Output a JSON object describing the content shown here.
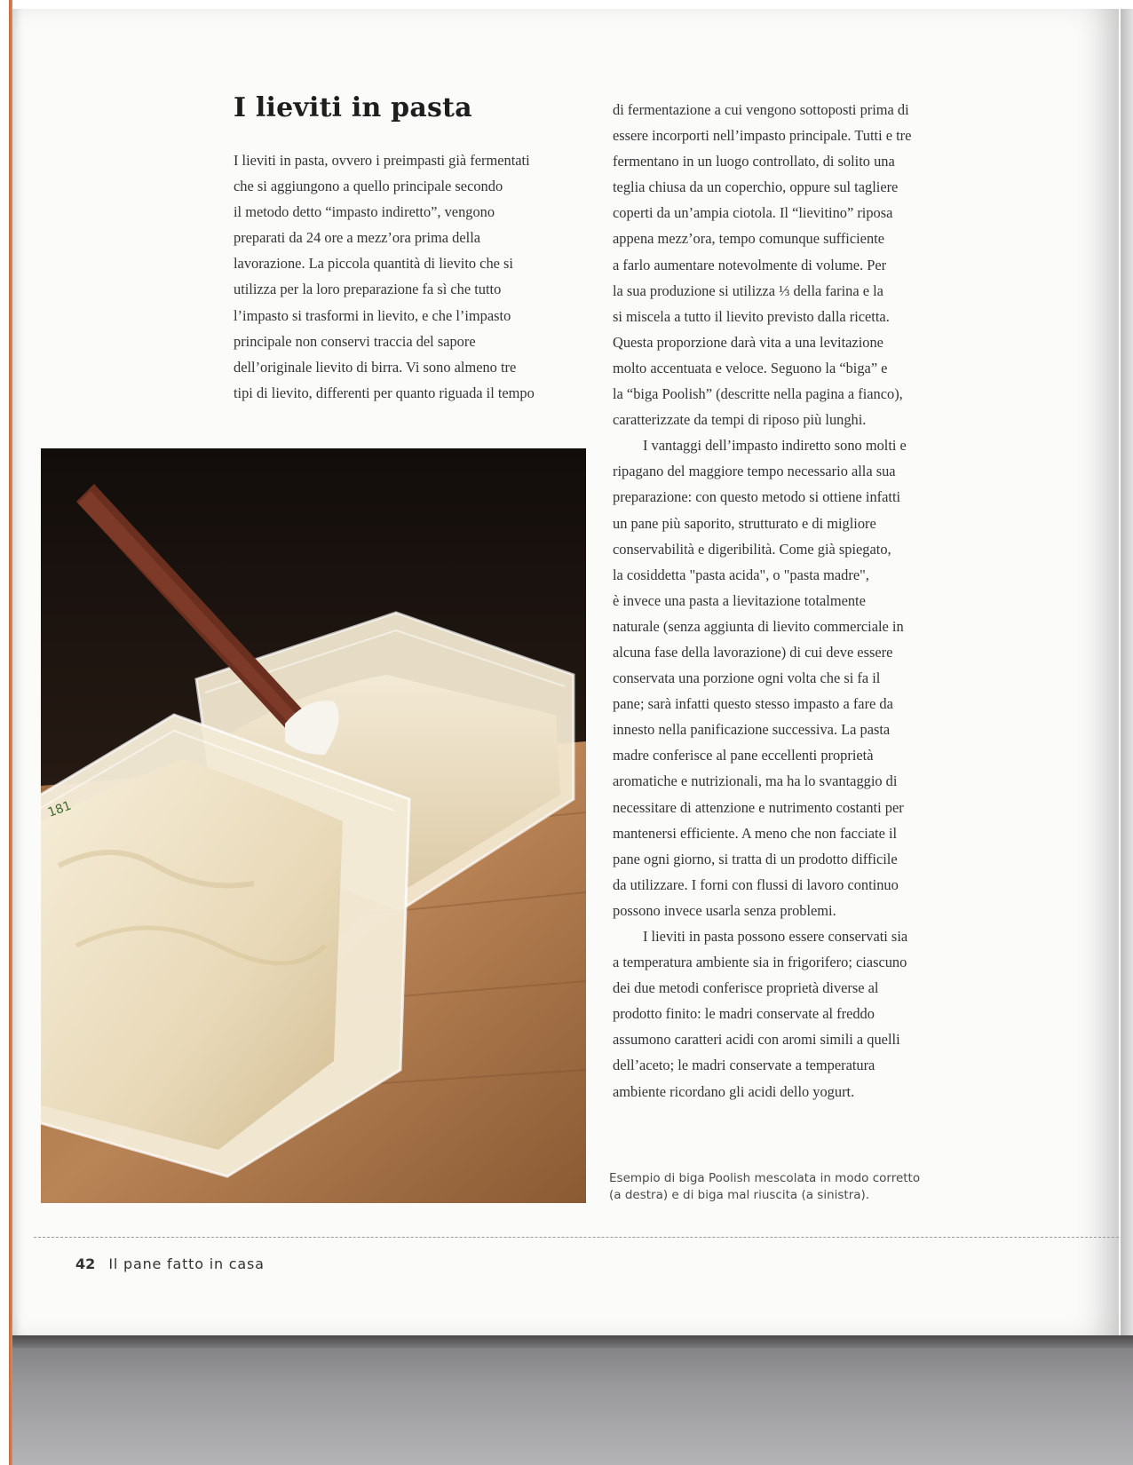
{
  "heading": "I lieviti in pasta",
  "left_column": [
    "I lieviti in pasta, ovvero i preimpasti già fermentati",
    "che si aggiungono a quello principale secondo",
    "il metodo detto “impasto indiretto”, vengono",
    "preparati da 24 ore a mezz’ora prima della",
    "lavorazione. La piccola quantità di lievito che si",
    "utilizza per la loro preparazione fa sì che tutto",
    "l’impasto si trasformi in lievito, e che l’impasto",
    "principale non conservi traccia del sapore",
    "dell’originale lievito di birra. Vi sono almeno tre",
    "tipi di lievito, differenti per quanto riguada il tempo"
  ],
  "right_column": [
    "di fermentazione a cui vengono sottoposti prima di",
    "essere incorporti nell’impasto principale. Tutti e tre",
    "fermentano in un luogo controllato, di solito una",
    "teglia chiusa da un coperchio, oppure sul tagliere",
    "coperti da un’ampia ciotola. Il “lievitino” riposa",
    "appena mezz’ora, tempo comunque sufficiente",
    "a farlo aumentare notevolmente di volume. Per",
    "la sua produzione si utilizza ⅓ della farina e la",
    "si miscela a tutto il lievito previsto dalla ricetta.",
    "Questa proporzione darà vita a una levitazione",
    "molto accentuata e veloce. Seguono la “biga” e",
    "la “biga Poolish” (descritte nella pagina a fianco),",
    "caratterizzate da tempi di riposo più lunghi.",
    "I vantaggi dell’impasto indiretto sono molti e",
    "ripagano del maggiore tempo necessario alla sua",
    "preparazione: con questo metodo si ottiene infatti",
    "un pane più saporito, strutturato e di migliore",
    "conservabilità e digeribilità. Come già spiegato,",
    "la cosiddetta \"pasta acida\", o \"pasta madre\",",
    "è invece una pasta a lievitazione totalmente",
    "naturale (senza aggiunta di lievito commerciale in",
    "alcuna fase della lavorazione) di cui deve essere",
    "conservata una porzione ogni volta che si fa il",
    "pane; sarà infatti questo stesso impasto a fare da",
    "innesto nella panificazione successiva. La pasta",
    "madre conferisce al pane eccellenti proprietà",
    "aromatiche e nutrizionali, ma ha lo svantaggio di",
    "necessitare di attenzione e nutrimento costanti per",
    "mantenersi efficiente. A meno che non facciate il",
    "pane ogni giorno, si tratta di un prodotto difficile",
    "da utilizzare. I forni con flussi di lavoro continuo",
    "possono invece usarla senza problemi.",
    "I lieviti in pasta possono essere conservati sia",
    "a temperatura ambiente sia in frigorifero; ciascuno",
    "dei due metodi conferisce proprietà diverse al",
    "prodotto finito: le madri conservate al freddo",
    "assumono caratteri acidi con aromi simili a quelli",
    "dell’aceto; le madri conservate a temperatura",
    "ambiente ricordano gli acidi dello yogurt."
  ],
  "photo_marking": "181",
  "caption": [
    "Esempio di biga Poolish mescolata in modo corretto",
    "(a destra) e di biga mal riuscita (a sinistra)."
  ],
  "folio": {
    "page_number": "42",
    "running_title": "Il pane fatto in casa"
  }
}
